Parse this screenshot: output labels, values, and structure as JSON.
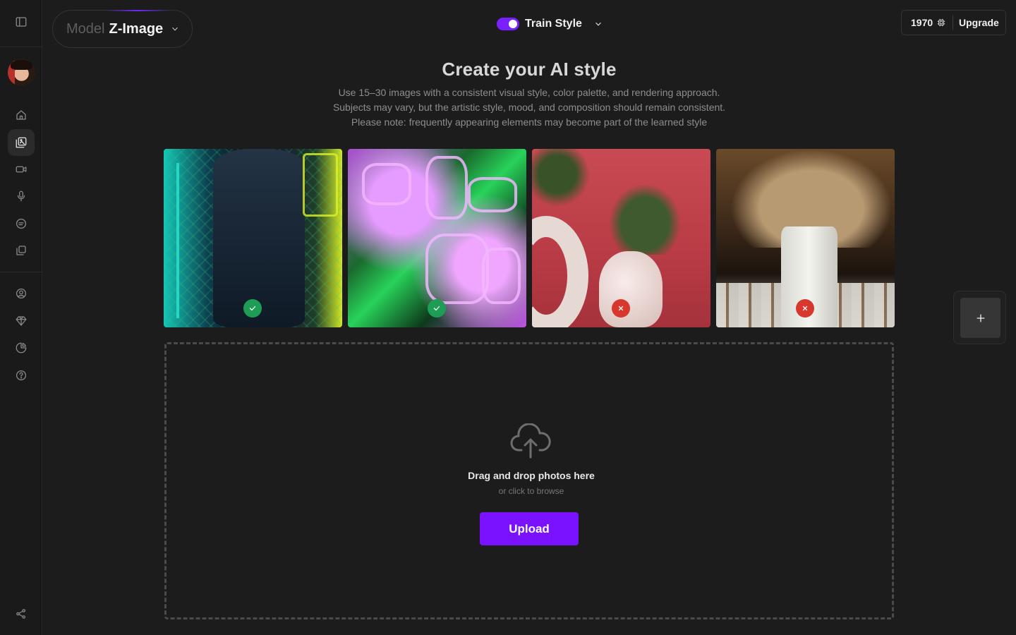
{
  "header": {
    "model_label": "Model",
    "model_value": "Z-Image",
    "train_style_label": "Train Style",
    "train_style_enabled": true,
    "credits": "1970",
    "upgrade_label": "Upgrade"
  },
  "sidebar": {
    "items": [
      {
        "icon": "panel-toggle-icon"
      },
      {
        "icon": "avatar"
      },
      {
        "icon": "home-icon"
      },
      {
        "icon": "image-gallery-icon",
        "active": true
      },
      {
        "icon": "video-camera-icon"
      },
      {
        "icon": "microphone-icon"
      },
      {
        "icon": "chat-icon"
      },
      {
        "icon": "copy-icon"
      },
      {
        "icon": "user-icon"
      },
      {
        "icon": "diamond-icon"
      },
      {
        "icon": "pie-chart-icon"
      },
      {
        "icon": "help-icon"
      },
      {
        "icon": "share-icon"
      }
    ]
  },
  "main": {
    "title": "Create your AI style",
    "description_lines": [
      "Use 15–30 images with a consistent visual style, color palette, and rendering approach.",
      "Subjects may vary, but the artistic style, mood, and composition should remain consistent.",
      "Please note: frequently appearing elements may become part of the learned style"
    ],
    "examples": [
      {
        "status": "approved"
      },
      {
        "status": "approved"
      },
      {
        "status": "rejected"
      },
      {
        "status": "rejected"
      }
    ],
    "dropzone": {
      "title": "Drag and drop photos here",
      "subtitle": "or click to browse",
      "upload_label": "Upload"
    }
  },
  "colors": {
    "accent": "#7a12ff",
    "approved": "#1e9e55",
    "rejected": "#d8372e",
    "background": "#1c1c1c"
  }
}
